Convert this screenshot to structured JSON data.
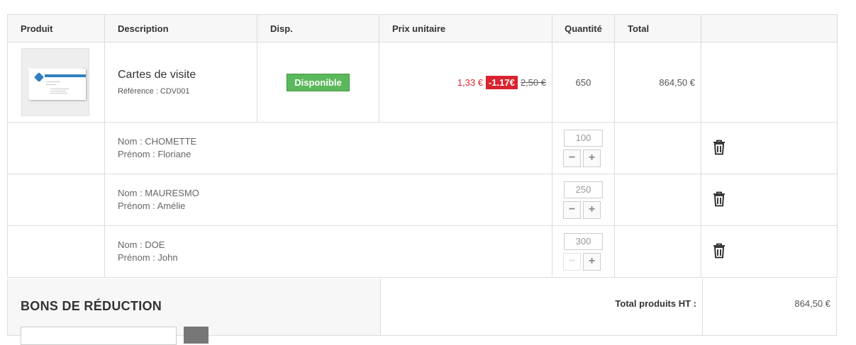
{
  "headers": {
    "product": "Produit",
    "description": "Description",
    "availability": "Disp.",
    "unit_price": "Prix unitaire",
    "quantity": "Quantité",
    "total": "Total"
  },
  "product": {
    "name": "Cartes de visite",
    "reference": "Référence : CDV001",
    "availability": "Disponible",
    "price_new": "1,33 €",
    "discount": "-1.17€",
    "price_old": "2,50 €",
    "quantity": "650",
    "total": "864,50 €"
  },
  "persons": [
    {
      "nom": "Nom : CHOMETTE",
      "prenom": "Prénom : Floriane",
      "qty": "100",
      "minus_enabled": true
    },
    {
      "nom": "Nom : MAURESMO",
      "prenom": "Prénom : Amélie",
      "qty": "250",
      "minus_enabled": true
    },
    {
      "nom": "Nom : DOE",
      "prenom": "Prénom : John",
      "qty": "300",
      "minus_enabled": false
    }
  ],
  "vouchers": {
    "title": "BONS DE RÉDUCTION"
  },
  "summary": {
    "label": "Total produits HT :",
    "value": "864,50 €"
  },
  "icons": {
    "minus": "minus-icon",
    "plus": "plus-icon",
    "trash": "trash-icon"
  },
  "colors": {
    "accent_red": "#d9232e",
    "available_green": "#5cb85c"
  }
}
